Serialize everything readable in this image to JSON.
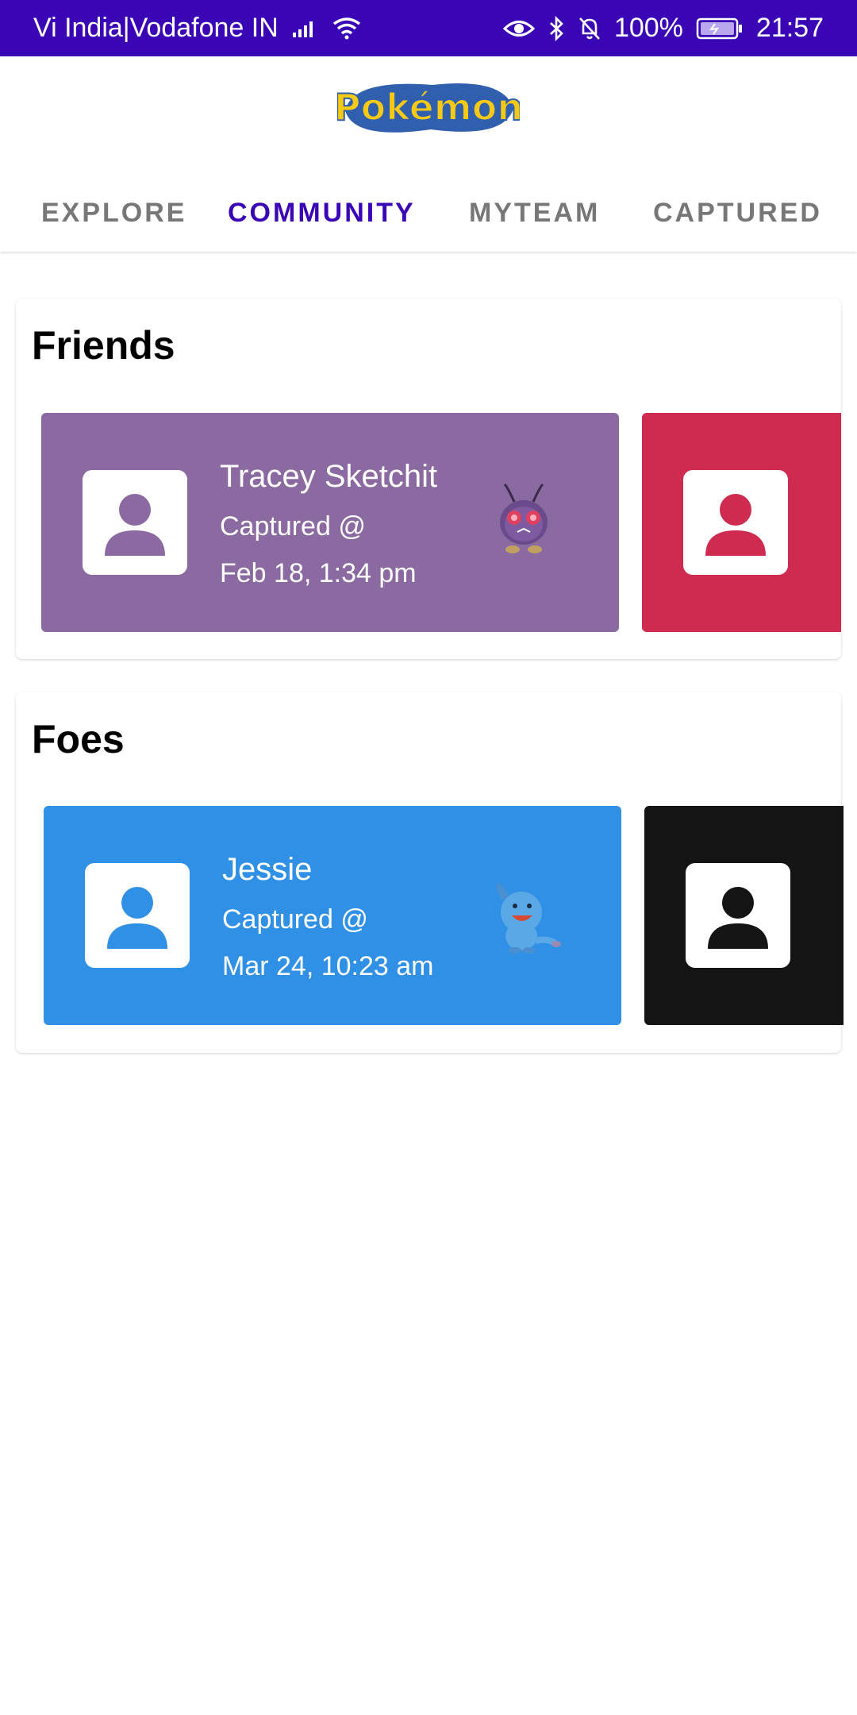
{
  "status_bar": {
    "carrier": "Vi India|Vodafone IN",
    "battery": "100%",
    "time": "21:57",
    "icons": [
      "signal-icon",
      "wifi-icon",
      "eye-icon",
      "bluetooth-icon",
      "bell-off-icon",
      "battery-icon"
    ]
  },
  "header": {
    "logo_text": "Pokémon",
    "tabs": [
      {
        "label": "EXPLORE",
        "active": false
      },
      {
        "label": "COMMUNITY",
        "active": true
      },
      {
        "label": "MYTEAM",
        "active": false
      },
      {
        "label": "CAPTURED",
        "active": false
      }
    ]
  },
  "colors": {
    "status_bar": "#3a06b5",
    "active_tab": "#3a06b5",
    "inactive_tab": "#777777",
    "friend_card_1": "#8a6aa0",
    "friend_card_2": "#cf2a50",
    "foe_card_1": "#3090e6",
    "foe_card_2": "#141414"
  },
  "friends": {
    "title": "Friends",
    "cards": [
      {
        "name": "Tracey Sketchit",
        "captured_label": "Captured @",
        "date": "Feb 18, 1:34 pm",
        "sprite": "venonat-sprite"
      },
      {
        "name": "",
        "captured_label": "",
        "date": "",
        "sprite": ""
      }
    ]
  },
  "foes": {
    "title": "Foes",
    "cards": [
      {
        "name": "Jessie",
        "captured_label": "Captured @",
        "date": "Mar 24, 10:23 am",
        "sprite": "wooper-sprite"
      },
      {
        "name": "",
        "captured_label": "",
        "date": "",
        "sprite": ""
      }
    ]
  }
}
